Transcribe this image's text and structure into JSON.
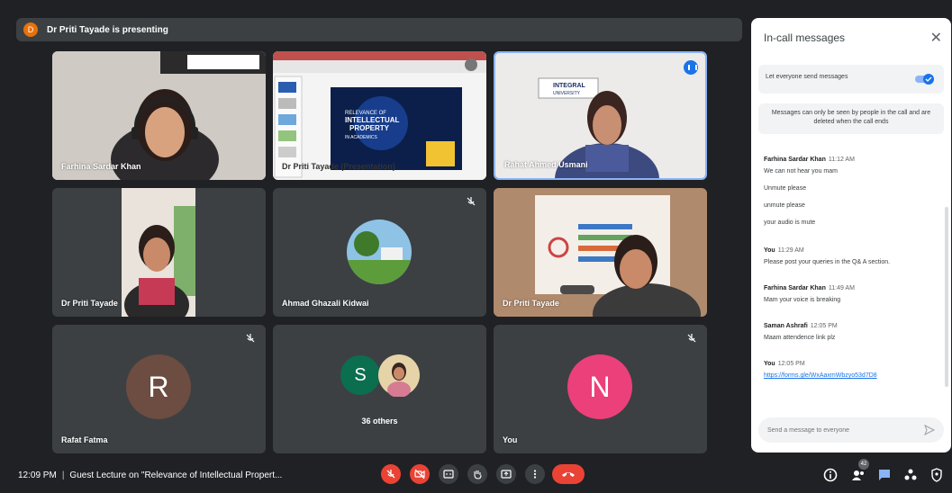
{
  "presenting": {
    "avatar_letter": "D",
    "text": "Dr Priti Tayade is presenting"
  },
  "tiles": [
    {
      "name": "Farhina Sardar Khan"
    },
    {
      "name": "Dr Priti Tayade (Presentation)",
      "slide_lines": [
        "RELEVANCE OF",
        "INTELLECTUAL",
        "PROPERTY",
        "IN ACADEMICS"
      ]
    },
    {
      "name": "Rahat Ahmed Usmani",
      "backdrop": [
        "INTEGRAL",
        "UNIVERSITY"
      ]
    },
    {
      "name": "Dr Priti Tayade"
    },
    {
      "name": "Ahmad Ghazali Kidwai"
    },
    {
      "name": "Dr Priti Tayade"
    },
    {
      "name": "Rafat Fatma",
      "avatar_letter": "R"
    },
    {
      "avatar_letter": "S",
      "others_label": "36 others"
    },
    {
      "name": "You",
      "avatar_letter": "N"
    }
  ],
  "panel": {
    "title": "In-call messages",
    "toggle_label": "Let everyone send messages",
    "notice": "Messages can only be seen by people in the call and are deleted when the call ends",
    "input_placeholder": "Send a message to everyone",
    "messages": [
      {
        "sender": "Farhina Sardar Khan",
        "time": "11:12 AM",
        "lines": [
          "We can not hear you mam",
          "Unmute please",
          "unmute please",
          "your audio is mute"
        ]
      },
      {
        "sender": "You",
        "time": "11:29 AM",
        "lines": [
          "Please post your queries in the Q& A section."
        ]
      },
      {
        "sender": "Farhina Sardar Khan",
        "time": "11:49 AM",
        "lines": [
          "Mam your voice is breaking"
        ]
      },
      {
        "sender": "Saman Ashrafi",
        "time": "12:05 PM",
        "lines": [
          "Maam attendence link plz"
        ]
      },
      {
        "sender": "You",
        "time": "12:05 PM",
        "lines": [
          "https://forms.gle/WxAaxmWbzyo53d7D8"
        ]
      }
    ]
  },
  "bottom": {
    "time": "12:09 PM",
    "meeting_title": "Guest Lecture on \"Relevance of Intellectual Propert...",
    "participants_count": "42"
  },
  "colors": {
    "accent": "#1a73e8",
    "danger": "#ea4335",
    "bg": "#202124",
    "tile": "#3c4043"
  }
}
